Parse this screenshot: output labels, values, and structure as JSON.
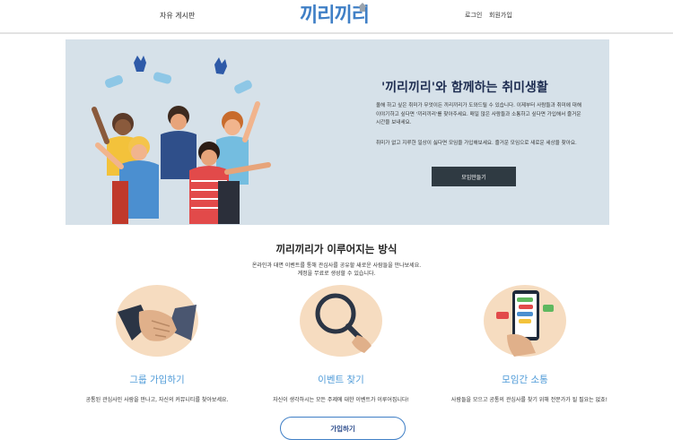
{
  "header": {
    "nav_board": "자유 게시판",
    "logo_text": "끼리끼리",
    "login": "로그인",
    "signup": "회원가입"
  },
  "hero": {
    "title": "'끼리끼리'와 함께하는 취미생활",
    "paragraph1": "올해 하고 싶은 취미가 무엇이든 끼리끼리가 도와드릴 수 있습니다. 이제부터 사람들과 취미에 대해 이야기하고 싶다면 '끼리끼리'를 찾아주세요. 매일 많은 사람들과 소통하고 싶다면 가입해서 즐거운 시간을 보내세요.",
    "paragraph2": "취미가 없고 지루한 일상이 싫다면 모임을 가입해보세요. 즐거운 모임으로 새로운 세상을 찾아요.",
    "button": "모임만들기"
  },
  "section": {
    "title": "끼리끼리가 이루어지는 방식",
    "desc1": "온라인과 대면 이벤트를 통해 관심사를 공유할 새로운 사람들을 만나보세요.",
    "desc2": "계정을 무료로 생성할 수 있습니다."
  },
  "features": [
    {
      "title": "그룹 가입하기",
      "desc": "공통된 관심사인 사람을 만나고, 자신의 커뮤니티를 찾아보세요."
    },
    {
      "title": "이벤트 찾기",
      "desc": "자신이 생각하시는 모든 주제에 대한 이벤트가 이루어집니다!"
    },
    {
      "title": "모임간 소통",
      "desc": "사람들을 모으고 공통의 관심사를 찾기 위해 전문가가 될 필요는 없죠!"
    }
  ],
  "join_button": "가입하기",
  "colors": {
    "brand_blue": "#3f7fc6",
    "hero_bg": "#d6e1e9",
    "dark_button": "#2f3a42",
    "feature_title": "#4f9bd8"
  }
}
